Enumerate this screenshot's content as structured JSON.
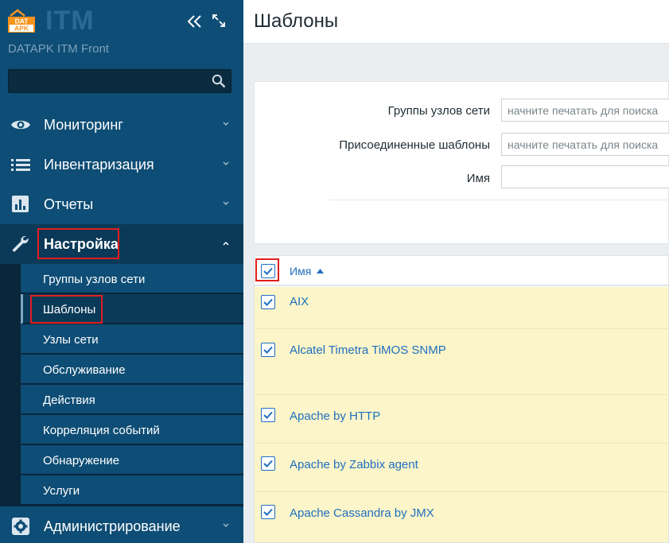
{
  "brand": {
    "logo_top": "DAT",
    "logo_bottom": "APK",
    "name": "ITM",
    "subtitle": "DATAPK ITM Front"
  },
  "search": {
    "placeholder": ""
  },
  "menu": [
    {
      "label": "Мониторинг",
      "icon": "eye-icon"
    },
    {
      "label": "Инвентаризация",
      "icon": "list-icon"
    },
    {
      "label": "Отчеты",
      "icon": "bar-chart-icon"
    },
    {
      "label": "Настройка",
      "icon": "wrench-icon"
    },
    {
      "label": "Администрирование",
      "icon": "gear-icon"
    }
  ],
  "submenu": [
    {
      "label": "Группы узлов сети"
    },
    {
      "label": "Шаблоны"
    },
    {
      "label": "Узлы сети"
    },
    {
      "label": "Обслуживание"
    },
    {
      "label": "Действия"
    },
    {
      "label": "Корреляция событий"
    },
    {
      "label": "Обнаружение"
    },
    {
      "label": "Услуги"
    }
  ],
  "page": {
    "title": "Шаблоны"
  },
  "filter": {
    "host_groups_label": "Группы узлов сети",
    "host_groups_placeholder": "начните печатать для поиска",
    "linked_templates_label": "Присоединенные шаблоны",
    "linked_templates_placeholder": "начните печатать для поиска",
    "name_label": "Имя",
    "name_value": ""
  },
  "table": {
    "column_name": "Имя",
    "sort": "ascending",
    "rows": [
      {
        "name": "AIX",
        "checked": true
      },
      {
        "name": "Alcatel Timetra TiMOS SNMP",
        "checked": true
      },
      {
        "name": "Apache by HTTP",
        "checked": true
      },
      {
        "name": "Apache by Zabbix agent",
        "checked": true
      },
      {
        "name": "Apache Cassandra by JMX",
        "checked": true
      }
    ]
  },
  "colors": {
    "sidebar": "#0e4d75",
    "highlight": "#e01e1e",
    "link": "#1f6fbf",
    "selected_row": "#fbf5c9"
  }
}
